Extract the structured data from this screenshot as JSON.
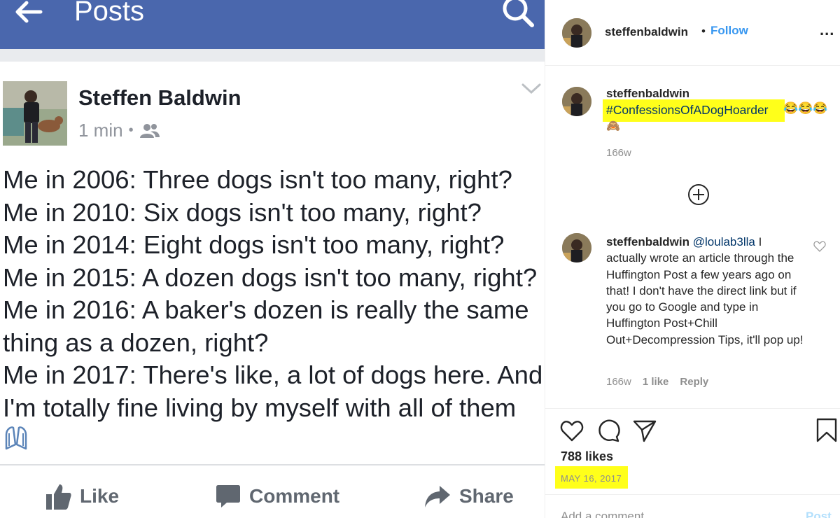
{
  "facebook": {
    "header": {
      "title": "Posts"
    },
    "post": {
      "author": "Steffen Baldwin",
      "time": "1 min",
      "separator": "•",
      "lines": [
        "Me in 2006: Three dogs isn't too many, right?",
        "Me in 2010: Six dogs isn't too many, right?",
        "Me in 2014: Eight dogs isn't too many, right?",
        "Me in 2015: A dozen dogs isn't too many, right?",
        "Me in 2016: A baker's dozen is really the same",
        "thing as a dozen, right?",
        "Me in 2017: There's like, a lot of dogs here. And",
        "I'm totally fine living by myself with all of them"
      ]
    },
    "actions": {
      "like": "Like",
      "comment": "Comment",
      "share": "Share"
    },
    "colors": {
      "header": "#4a67ad",
      "text": "#1d2129",
      "muted": "#606770"
    }
  },
  "instagram": {
    "header": {
      "username": "steffenbaldwin",
      "bullet": "•",
      "follow": "Follow",
      "more": "..."
    },
    "caption": {
      "username": "steffenbaldwin",
      "hashtag": "#ConfessionsOfADogHoarder",
      "emojis": "😂😂😂",
      "emoji_line2": "🙈",
      "time": "166w"
    },
    "reply": {
      "username": "steffenbaldwin",
      "mention": "@loulab3lla",
      "text": "I actually wrote an article through the Huffington Post a few years ago on that! I don't have the direct link but if you go to Google and type in Huffington Post+Chill Out+Decompression Tips, it'll pop up!",
      "time": "166w",
      "likes": "1 like",
      "reply_label": "Reply"
    },
    "likes": "788 likes",
    "date": "MAY 16, 2017",
    "add_comment_placeholder": "Add a comment...",
    "post_label": "Post",
    "colors": {
      "link": "#3897f0",
      "highlight": "#ffff1a",
      "muted": "#8e8e8e"
    }
  }
}
